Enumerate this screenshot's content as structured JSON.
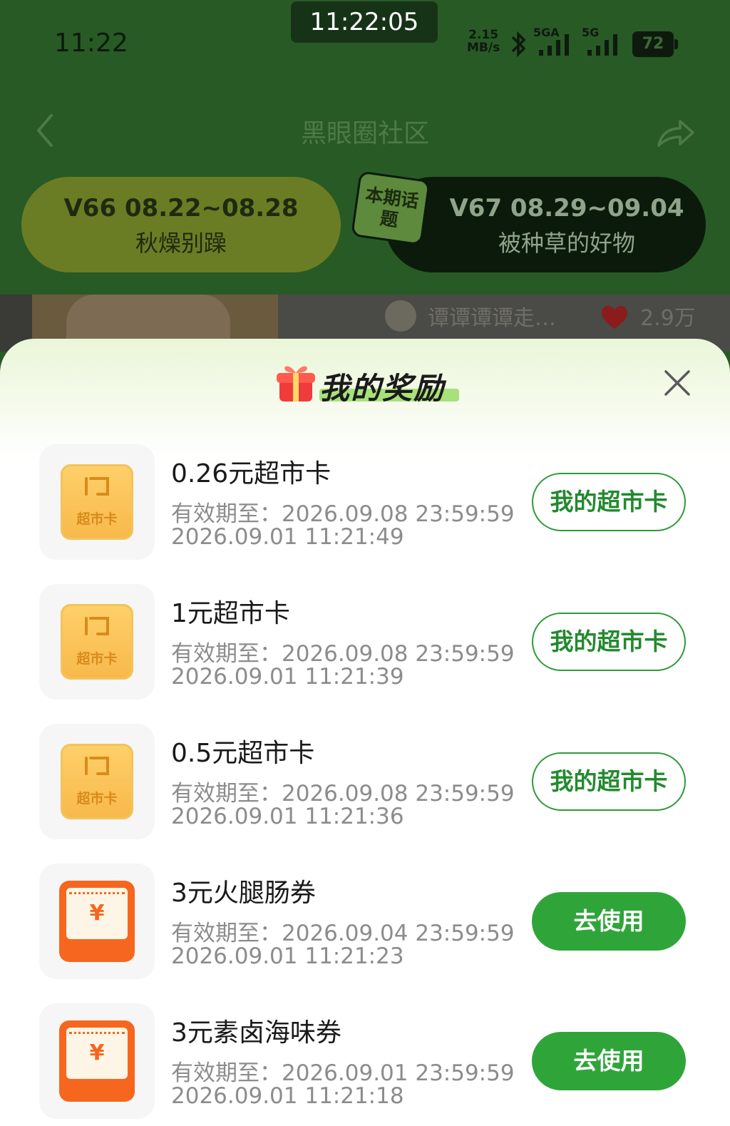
{
  "status_bar": {
    "time": "11:22",
    "clock": "11:22:05",
    "net_speed_value": "2.15",
    "net_speed_unit": "MB/s",
    "sim1_label": "5GA",
    "sim2_label": "5G",
    "battery": "72"
  },
  "nav": {
    "title": "黑眼圈社区"
  },
  "periods": {
    "previous": {
      "range": "V66 08.22~08.28",
      "topic": "秋燥别躁"
    },
    "current": {
      "badge": "本期话题",
      "range": "V67 08.29~09.04",
      "topic": "被种草的好物"
    }
  },
  "feed_preview": {
    "author": "谭谭谭谭走…",
    "likes": "2.9万"
  },
  "rewards_sheet": {
    "title": "我的奖励",
    "items": [
      {
        "name": "0.26元超市卡",
        "expire": "有效期至：2026.09.08 23:59:59",
        "time": "2026.09.01 11:21:49",
        "icon_type": "supermarket-card",
        "icon_label": "超市卡",
        "action": "我的超市卡",
        "action_style": "outline"
      },
      {
        "name": "1元超市卡",
        "expire": "有效期至：2026.09.08 23:59:59",
        "time": "2026.09.01 11:21:39",
        "icon_type": "supermarket-card",
        "icon_label": "超市卡",
        "action": "我的超市卡",
        "action_style": "outline"
      },
      {
        "name": "0.5元超市卡",
        "expire": "有效期至：2026.09.08 23:59:59",
        "time": "2026.09.01 11:21:36",
        "icon_type": "supermarket-card",
        "icon_label": "超市卡",
        "action": "我的超市卡",
        "action_style": "outline"
      },
      {
        "name": "3元火腿肠券",
        "expire": "有效期至：2026.09.04 23:59:59",
        "time": "2026.09.01 11:21:23",
        "icon_type": "coupon-ticket",
        "icon_label": "¥",
        "action": "去使用",
        "action_style": "filled"
      },
      {
        "name": "3元素卤海味券",
        "expire": "有效期至：2026.09.01 23:59:59",
        "time": "2026.09.01 11:21:18",
        "icon_type": "coupon-ticket",
        "icon_label": "¥",
        "action": "去使用",
        "action_style": "filled"
      }
    ]
  },
  "colors": {
    "header_green": "#285a25",
    "action_green": "#2fa539",
    "card_yellow": "#ffc85a",
    "ticket_orange": "#f6661e"
  }
}
